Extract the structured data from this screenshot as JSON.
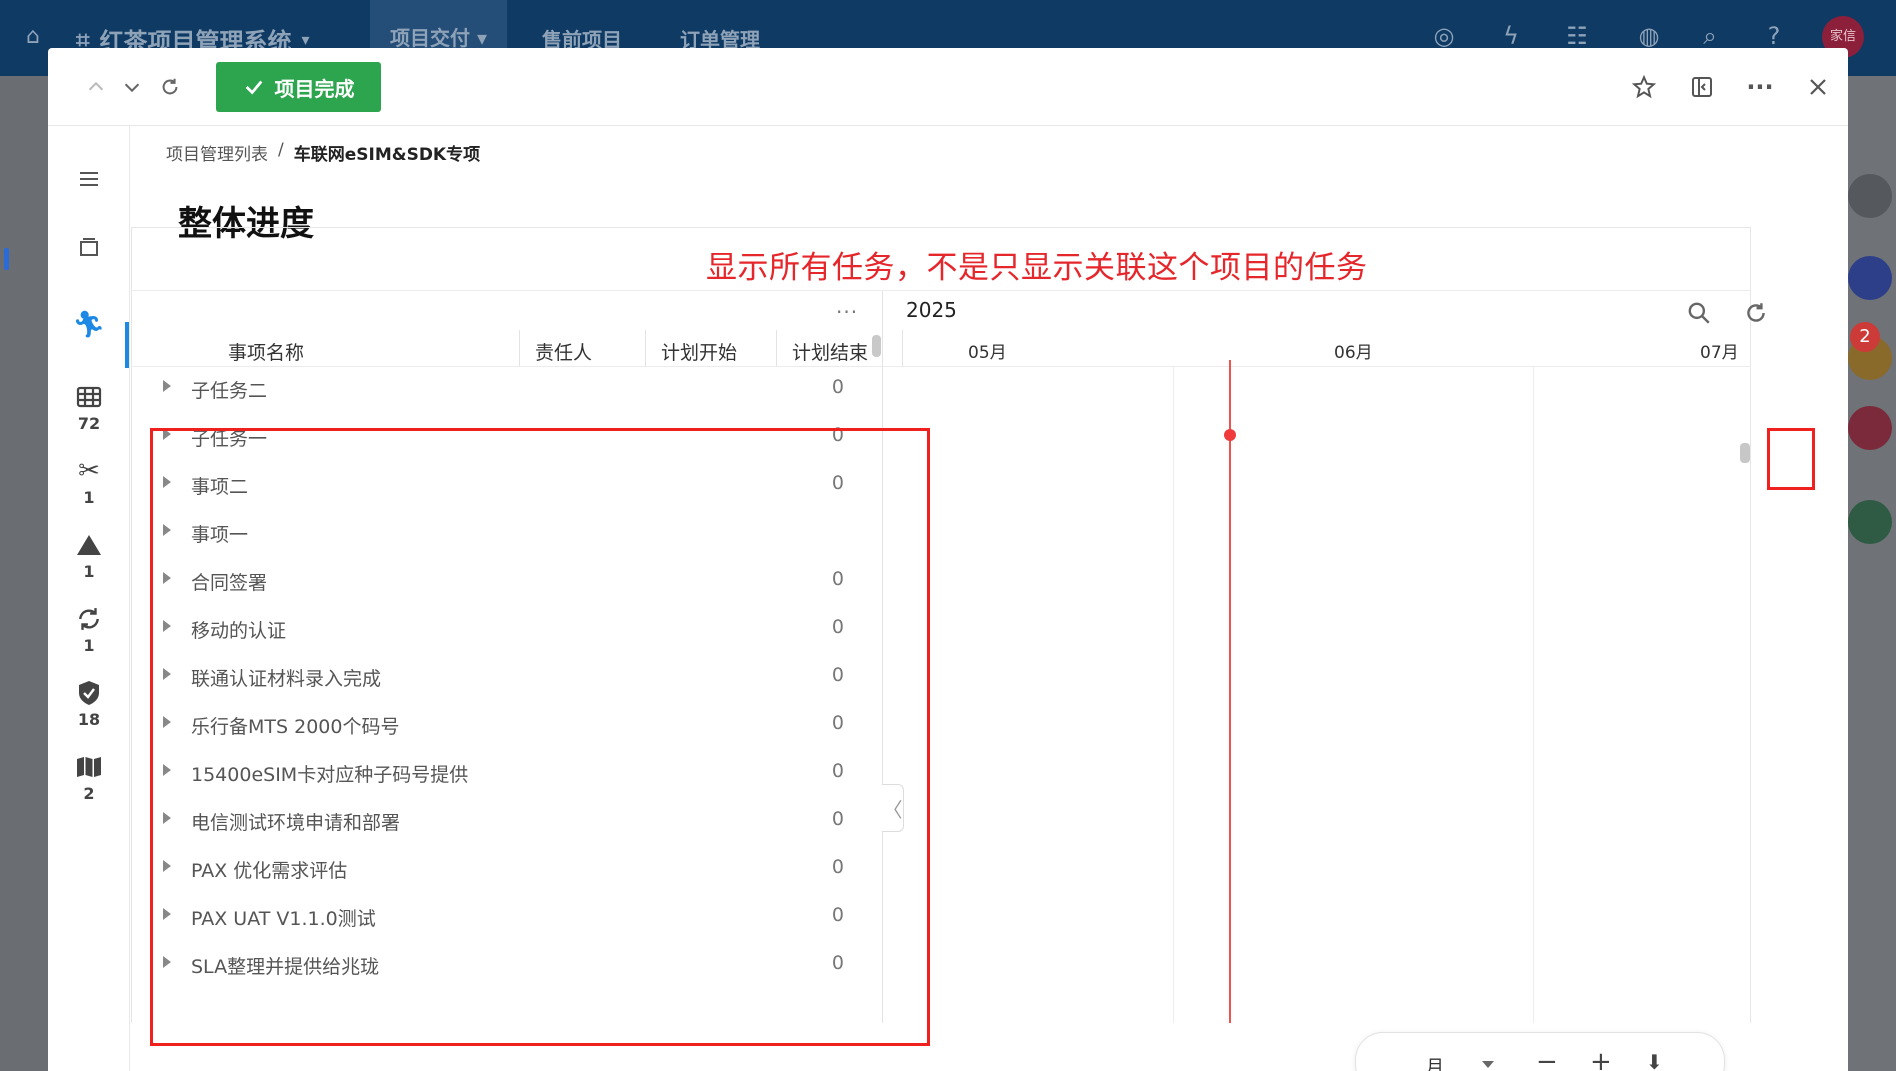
{
  "bg": {
    "app_title": "红茶项目管理系统",
    "nav": [
      "项目交付",
      "售前项目",
      "订单管理"
    ],
    "avatar": "家信",
    "badge": "2"
  },
  "toolbar": {
    "complete_label": "项目完成"
  },
  "rail": {
    "counts": [
      "72",
      "1",
      "1",
      "1",
      "18",
      "2"
    ]
  },
  "breadcrumb": {
    "root": "项目管理列表",
    "sep": "/",
    "current": "车联网eSIM&SDK专项"
  },
  "page_title": "整体进度",
  "annotation": "显示所有任务，不是只显示关联这个项目的任务",
  "grid": {
    "more": "···",
    "columns": [
      "事项名称",
      "责任人",
      "计划开始",
      "计划结束"
    ],
    "rows": [
      {
        "name": "子任务二",
        "count": "0"
      },
      {
        "name": "子任务一",
        "count": "0"
      },
      {
        "name": "事项二",
        "count": "0"
      },
      {
        "name": "事项一",
        "count": ""
      },
      {
        "name": "合同签署",
        "count": "0"
      },
      {
        "name": "移动的认证",
        "count": "0"
      },
      {
        "name": "联通认证材料录入完成",
        "count": "0"
      },
      {
        "name": "乐行备MTS 2000个码号",
        "count": "0"
      },
      {
        "name": "15400eSIM卡对应种子码号提供",
        "count": "0"
      },
      {
        "name": "电信测试环境申请和部署",
        "count": "0"
      },
      {
        "name": "PAX 优化需求评估",
        "count": "0"
      },
      {
        "name": "PAX UAT V1.1.0测试",
        "count": "0"
      },
      {
        "name": "SLA整理并提供给兆珑",
        "count": "0"
      }
    ]
  },
  "gantt": {
    "year": "2025",
    "months": [
      "05月",
      "06月",
      "07月"
    ]
  },
  "zoom": {
    "unit": "月",
    "minus": "−",
    "plus": "+",
    "download": "⬇"
  },
  "colors": {
    "accent_green": "#2da44e",
    "annotation_red": "#e5262b",
    "today_red": "#ef5350",
    "topbar": "#0f3a63"
  }
}
